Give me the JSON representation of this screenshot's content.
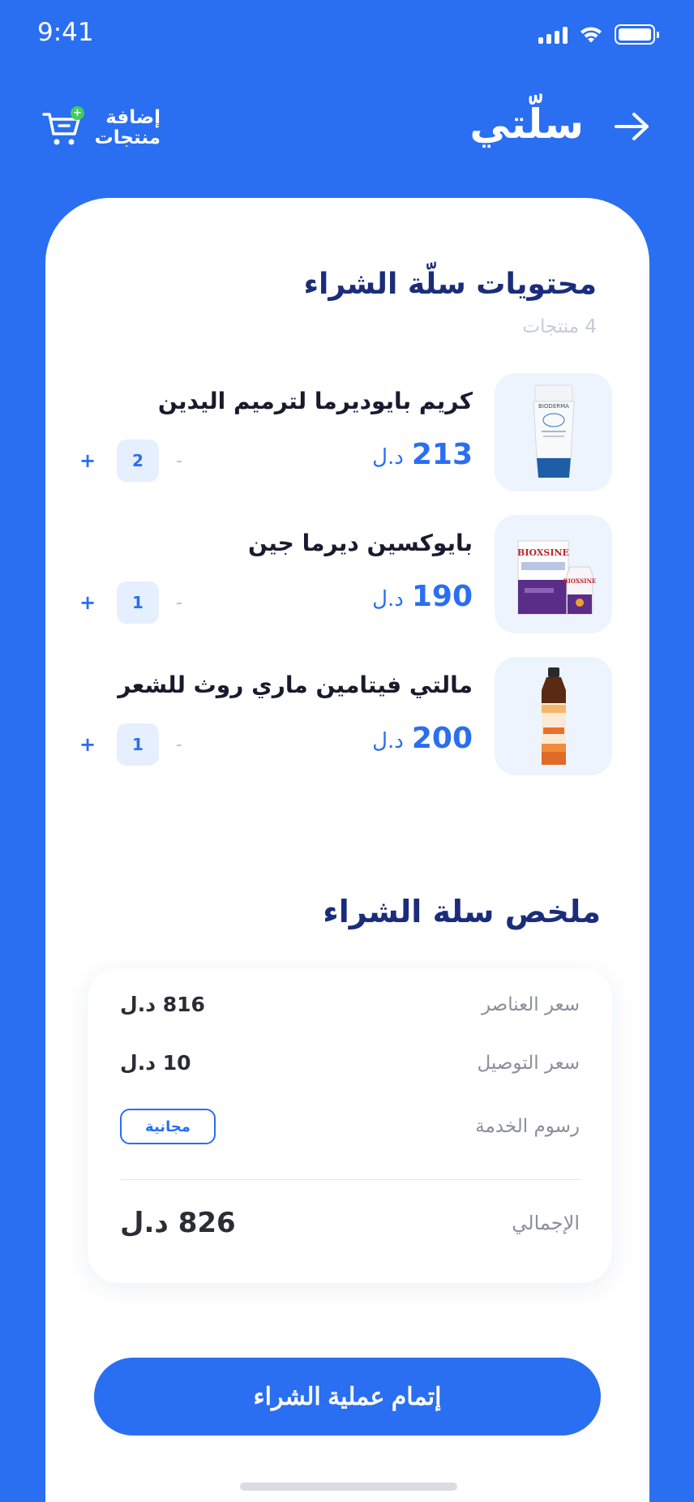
{
  "status_bar": {
    "time": "9:41"
  },
  "header": {
    "title": "سلّتي",
    "add_products_label_line1": "إضافة",
    "add_products_label_line2": "منتجات"
  },
  "cart": {
    "title": "محتويات سلّة الشراء",
    "count_text": "4 منتجات",
    "currency": "د.ل",
    "items": [
      {
        "name": "كريم بايوديرما لترميم اليدين",
        "price": "213",
        "qty": "2",
        "image": "bioderma-hand-cream"
      },
      {
        "name": "بايوكسين ديرما جين",
        "price": "190",
        "qty": "1",
        "image": "bioxsine-box-bottle"
      },
      {
        "name": "مالتي فيتامين ماري روث للشعر",
        "price": "200",
        "qty": "1",
        "image": "mary-ruth-multivitamin-bottle"
      }
    ],
    "plus_symbol": "+",
    "minus_symbol": "-"
  },
  "summary": {
    "title": "ملخص سلة الشراء",
    "items_price_label": "سعر العناصر",
    "items_price_value": "816 د.ل",
    "delivery_label": "سعر التوصيل",
    "delivery_value": "10 د.ل",
    "service_label": "رسوم الخدمة",
    "service_value": "مجانية",
    "total_label": "الإجمالي",
    "total_value": "826 د.ل"
  },
  "checkout_label": "إتمام عملية الشراء",
  "colors": {
    "brand": "#2a6ef2",
    "title": "#1b2d7a",
    "badge_green": "#3fcf5a"
  }
}
